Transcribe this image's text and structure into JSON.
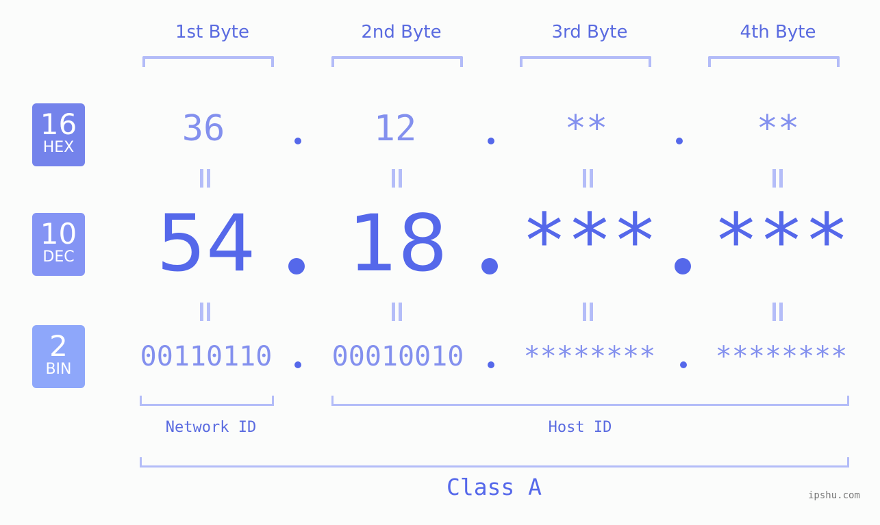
{
  "bytes": [
    {
      "label": "1st Byte",
      "hex": "36",
      "dec": "54",
      "bin": "00110110"
    },
    {
      "label": "2nd Byte",
      "hex": "12",
      "dec": "18",
      "bin": "00010010"
    },
    {
      "label": "3rd Byte",
      "hex": "**",
      "dec": "***",
      "bin": "********"
    },
    {
      "label": "4th Byte",
      "hex": "**",
      "dec": "***",
      "bin": "********"
    }
  ],
  "bases": [
    {
      "number": "16",
      "name": "HEX"
    },
    {
      "number": "10",
      "name": "DEC"
    },
    {
      "number": "2",
      "name": "BIN"
    }
  ],
  "segments": {
    "network": "Network ID",
    "host": "Host ID"
  },
  "ip_class": "Class A",
  "watermark": "ipshu.com",
  "colors": {
    "accent": "#5568ea",
    "light_accent": "#8390ee",
    "bracket": "#b3bcf8",
    "hex_badge": "#7483eb",
    "dec_badge": "#8494f4",
    "bin_badge": "#8ea7fa"
  }
}
